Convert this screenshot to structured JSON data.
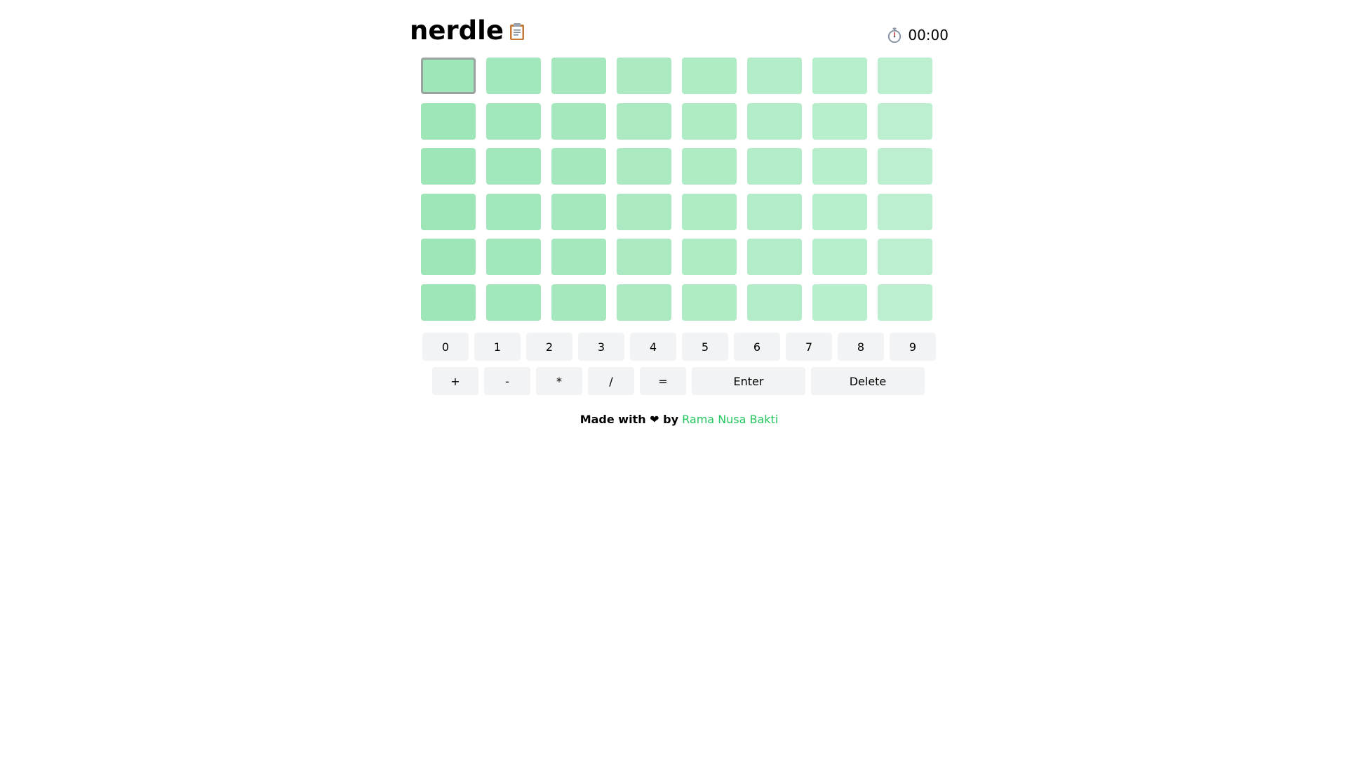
{
  "header": {
    "title": "nerdle",
    "clipboard_icon": "clipboard-icon",
    "timer_icon": "stopwatch-icon",
    "timer": "00:00"
  },
  "board": {
    "rows": 6,
    "columns": 8,
    "active_tile": {
      "row": 1,
      "column": 1
    },
    "tile_colors": [
      "#9ee5b8",
      "#a2e6bb",
      "#a6e8be",
      "#aae9c1",
      "#afebc5",
      "#b3ecc8",
      "#b7eecb",
      "#bcefcf"
    ],
    "active_border_color": "#9aa49e"
  },
  "keyboard": {
    "digits": [
      "0",
      "1",
      "2",
      "3",
      "4",
      "5",
      "6",
      "7",
      "8",
      "9"
    ],
    "operators": [
      "+",
      "-",
      "*",
      "/",
      "="
    ],
    "enter": "Enter",
    "delete": "Delete",
    "key_bg": "#f2f3f4"
  },
  "footer": {
    "made_with": "Made with",
    "heart": "❤",
    "by": "by",
    "author": "Rama Nusa Bakti",
    "author_color": "#22c55e"
  }
}
